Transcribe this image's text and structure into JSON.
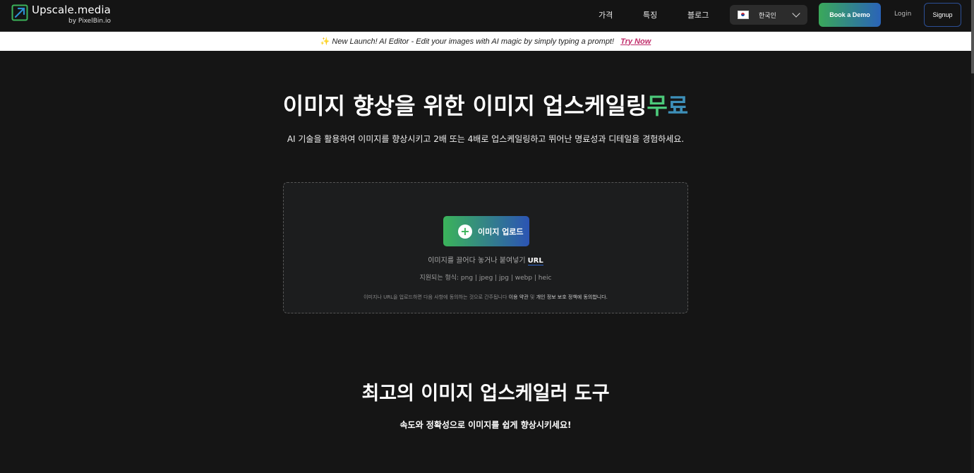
{
  "nav": {
    "logo_name": "Upscale.media",
    "logo_sub": "by PixelBin.io",
    "links": [
      "가격",
      "특징",
      "블로그"
    ],
    "language": "한국인",
    "book_demo": "Book a Demo",
    "login": "Login",
    "signup": "Signup"
  },
  "banner": {
    "text": "New Launch! AI Editor - Edit your images with AI magic by simply typing a prompt!",
    "link": "Try Now"
  },
  "hero": {
    "title": "이미지 향상을 위한 이미지 업스케일링",
    "title_free_1": "무",
    "title_free_2": "료",
    "subtitle": "AI 기술을 활용하여 이미지를 향상시키고 2배 또는 4배로 업스케일링하고 뛰어난 명료성과 디테일을 경험하세요."
  },
  "upload": {
    "button": "이미지 업로드",
    "drop_text": "이미지를 끌어다 놓거나 붙여넣기",
    "url": "URL",
    "formats": "지원되는 형식:  png | jpeg | jpg | webp | heic",
    "terms_prefix": "이미지나 URL을 업로드하면 다음 사항에 동의하는 것으로 간주됩니다",
    "terms_link": "이용 약관",
    "terms_and": "및",
    "privacy_link": "개인 정보 보호 정책에 동의합니다."
  },
  "section": {
    "title": "최고의 이미지 업스케일러 도구",
    "subtitle": "속도와 정확성으로 이미지를 쉽게 향상시키세요!"
  },
  "colors": {
    "background": "#151515",
    "accent_green": "#3bb35a",
    "accent_blue": "#2c54b4",
    "banner_link": "#c02c6a"
  },
  "icons": {
    "logo": "upscale-arrow-icon",
    "flag": "korea-flag-icon",
    "dropdown": "chevron-down-icon",
    "upload": "plus-icon",
    "banner": "sparkles-icon"
  }
}
